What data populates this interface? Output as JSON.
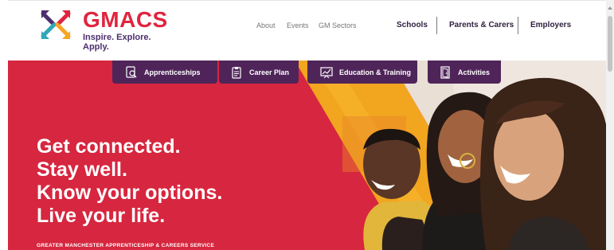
{
  "brand": {
    "name": "GMACS",
    "tagline": "Inspire. Explore. Apply.",
    "colors": {
      "red": "#e0243f",
      "purple": "#4f2559",
      "orange": "#f5a623",
      "teal": "#2fa7b8"
    }
  },
  "nav": {
    "small": [
      "About",
      "Events",
      "GM Sectors"
    ],
    "main": [
      "Schools",
      "Parents & Carers",
      "Employers"
    ]
  },
  "categories": [
    {
      "label": "Apprenticeships",
      "icon": "search-certificate-icon"
    },
    {
      "label": "Career Plan",
      "icon": "clipboard-icon"
    },
    {
      "label": "Education & Training",
      "icon": "chart-board-icon"
    },
    {
      "label": "Activities",
      "icon": "door-exit-icon"
    }
  ],
  "hero": {
    "lines": [
      "Get connected.",
      "Stay well.",
      "Know your options.",
      "Live your life."
    ],
    "subheading": "GREATER MANCHESTER APPRENTICESHIP & CAREERS SERVICE"
  }
}
